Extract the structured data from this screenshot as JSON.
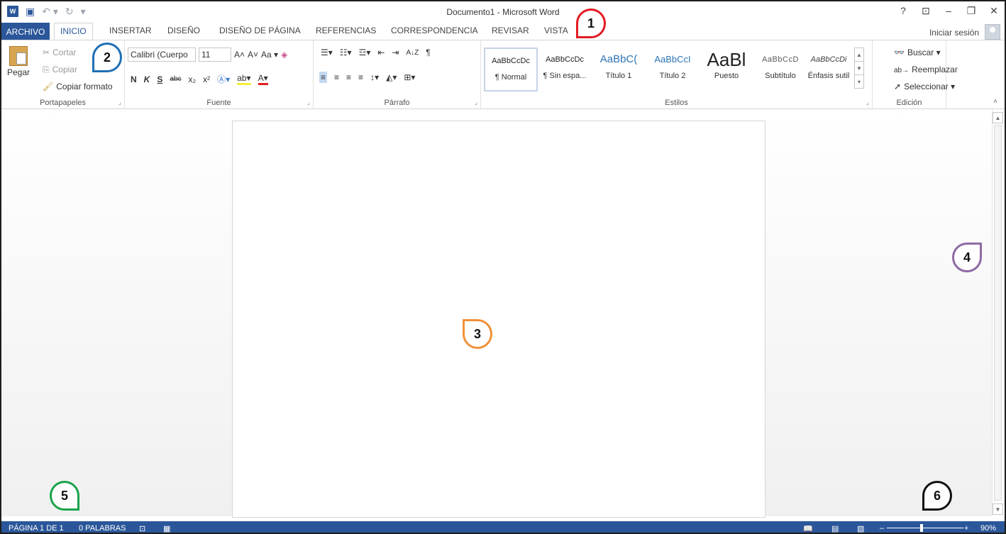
{
  "window": {
    "title": "Documento1 - Microsoft Word",
    "controls": [
      "?",
      "⧉",
      "–",
      "🗗",
      "✕"
    ]
  },
  "qat": {
    "app_icon": "W",
    "save": "💾",
    "undo": "↶ ▾",
    "redo": "↻",
    "customize": "▾"
  },
  "tabs": {
    "file": "ARCHIVO",
    "items": [
      "INICIO",
      "INSERTAR",
      "DISEÑO",
      "DISEÑO DE PÁGINA",
      "REFERENCIAS",
      "CORRESPONDENCIA",
      "REVISAR",
      "VISTA"
    ],
    "sign_in": "Iniciar sesión"
  },
  "clipboard": {
    "paste": "Pegar",
    "cut": "Cortar",
    "copy": "Copiar",
    "format_painter": "Copiar formato",
    "label": "Portapapeles"
  },
  "font": {
    "name": "Calibri (Cuerpo",
    "size": "11",
    "grow": "A˄",
    "shrink": "A˅",
    "change_case": "Aa ▾",
    "bold": "N",
    "italic": "K",
    "underline": "S",
    "strikethrough": "abc",
    "subscript": "x₂",
    "superscript": "x²",
    "label": "Fuente"
  },
  "paragraph": {
    "label": "Párrafo",
    "sort": "A↓Z",
    "pilcrow": "¶"
  },
  "styles": {
    "label": "Estilos",
    "items": [
      {
        "preview": "AaBbCcDc",
        "name": "¶ Normal"
      },
      {
        "preview": "AaBbCcDc",
        "name": "¶ Sin espa..."
      },
      {
        "preview": "AaBbC(",
        "name": "Título 1"
      },
      {
        "preview": "AaBbCcI",
        "name": "Título 2"
      },
      {
        "preview": "AaBl",
        "name": "Puesto"
      },
      {
        "preview": "AaBbCcD",
        "name": "Subtítulo"
      },
      {
        "preview": "AaBbCcDi",
        "name": "Énfasis sutil"
      }
    ]
  },
  "editing": {
    "find": "Buscar",
    "replace": "Reemplazar",
    "select": "Seleccionar",
    "label": "Edición"
  },
  "status": {
    "page": "PÁGINA 1 DE 1",
    "words": "0 PALABRAS",
    "zoom": "90%",
    "zoom_minus": "–",
    "zoom_plus": "+",
    "zoom_fraction": 0.9
  },
  "callouts": [
    "1",
    "2",
    "3",
    "4",
    "5",
    "6"
  ],
  "colors": {
    "accent": "#2b579a",
    "callout_1": "#e21b23",
    "callout_2": "#1f6fb5",
    "callout_3": "#f0913a",
    "callout_4": "#8e6aa3",
    "callout_5": "#1aa34a",
    "callout_6": "#111111"
  }
}
